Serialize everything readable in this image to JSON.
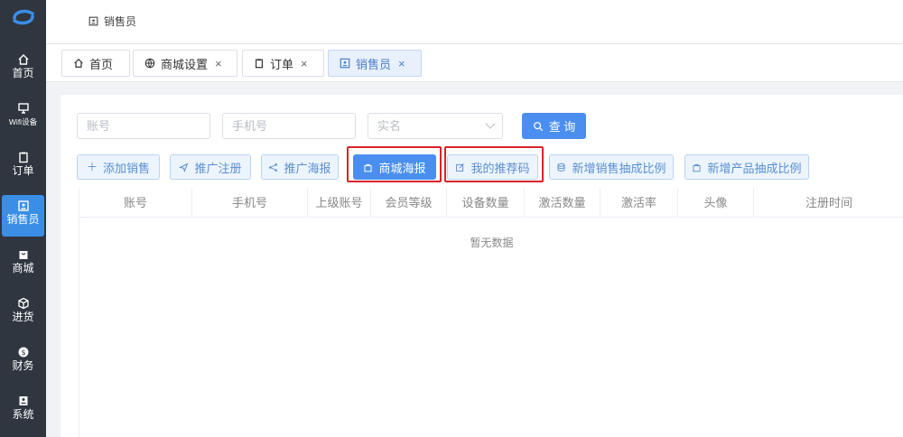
{
  "sidebar": {
    "items": [
      {
        "label": "首页",
        "icon": "home-icon"
      },
      {
        "label": "Wifi设备",
        "icon": "monitor-icon"
      },
      {
        "label": "订单",
        "icon": "clipboard-icon"
      },
      {
        "label": "销售员",
        "icon": "id-card-icon",
        "active": true
      },
      {
        "label": "商城",
        "icon": "store-icon"
      },
      {
        "label": "进货",
        "icon": "box-icon"
      },
      {
        "label": "财务",
        "icon": "coin-icon"
      },
      {
        "label": "系统",
        "icon": "system-icon"
      }
    ]
  },
  "header": {
    "breadcrumb": "销售员"
  },
  "tabs": [
    {
      "label": "首页",
      "icon": "home-icon",
      "closable": false
    },
    {
      "label": "商城设置",
      "icon": "globe-icon",
      "closable": true
    },
    {
      "label": "订单",
      "icon": "clipboard-icon",
      "closable": true
    },
    {
      "label": "销售员",
      "icon": "id-card-icon",
      "closable": true,
      "active": true
    }
  ],
  "tab_close_symbol": "×",
  "filters": {
    "account_placeholder": "账号",
    "phone_placeholder": "手机号",
    "realname_placeholder": "实名",
    "search_label": "查 询"
  },
  "actions": {
    "add_sales": "添加销售",
    "promo_register": "推广注册",
    "promo_poster": "推广海报",
    "mall_poster": "商城海报",
    "my_referral_code": "我的推荐码",
    "new_sales_commission": "新增销售抽成比例",
    "new_product_commission": "新增产品抽成比例"
  },
  "table": {
    "columns": [
      "账号",
      "手机号",
      "上级账号",
      "会员等级",
      "设备数量",
      "激活数量",
      "激活率",
      "头像",
      "注册时间"
    ],
    "empty_text": "暂无数据"
  },
  "colors": {
    "sidebar_bg": "#2f3640",
    "accent": "#4a8ff0",
    "highlight": "#d9232a"
  }
}
